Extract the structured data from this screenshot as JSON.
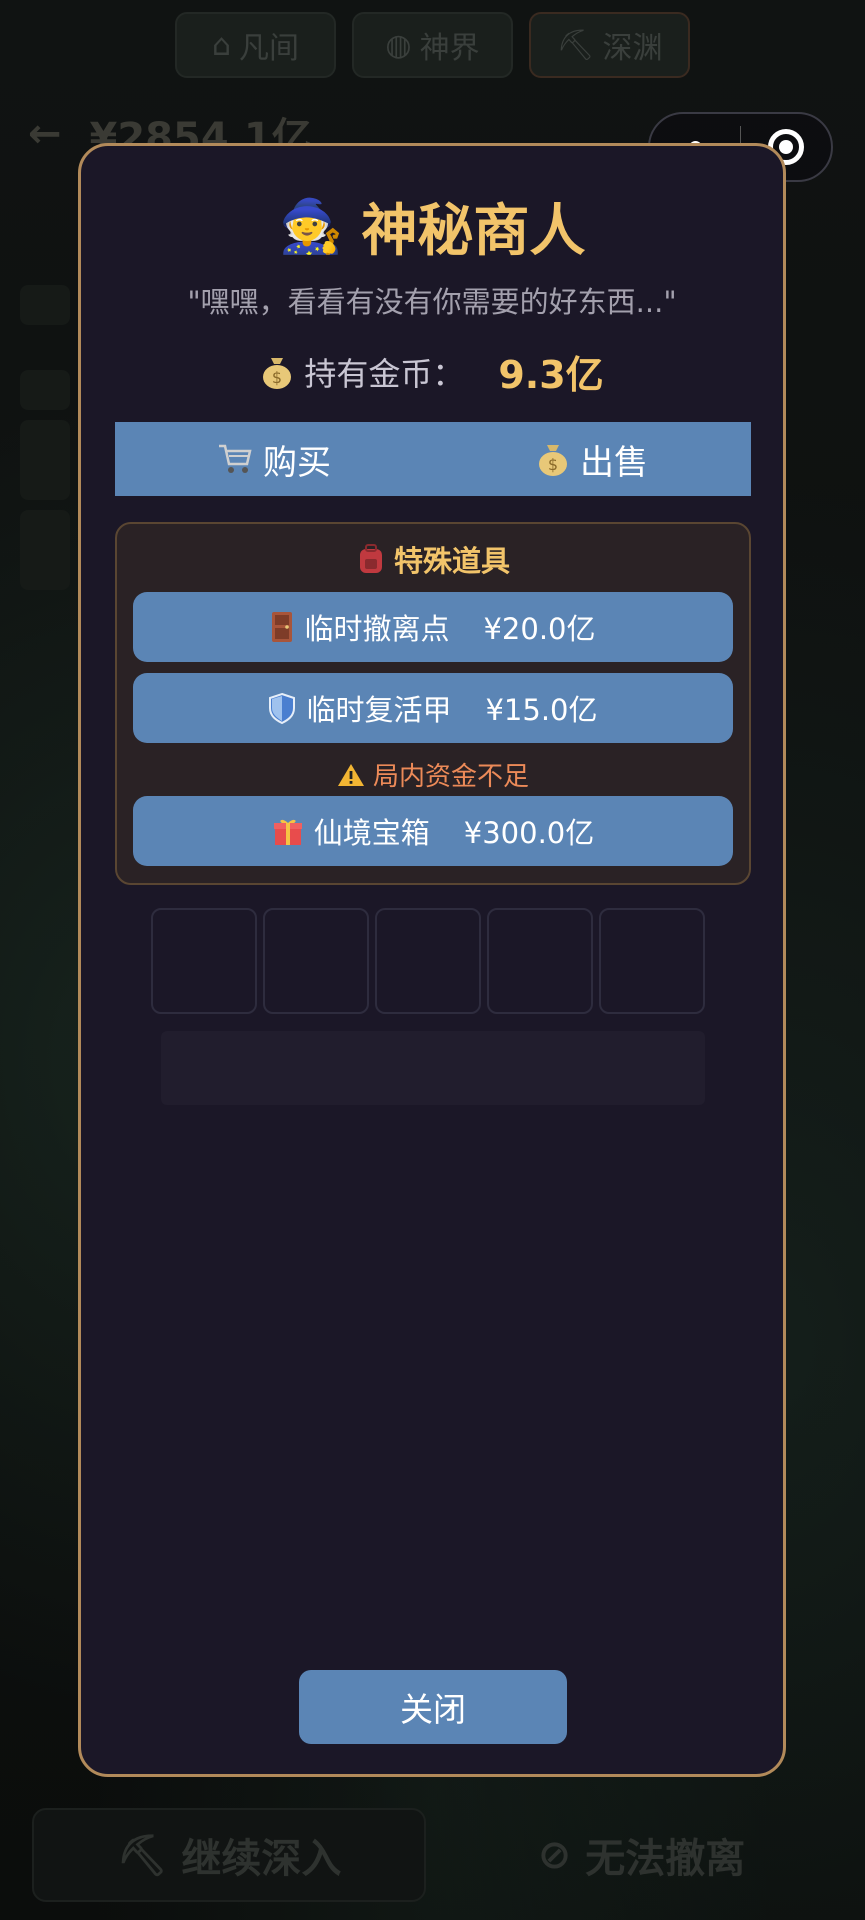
{
  "background": {
    "tabs": [
      "凡间",
      "神界",
      "深渊"
    ],
    "balance": "¥2854.1亿",
    "continue_label": "继续深入",
    "withdraw_label": "无法撤离"
  },
  "merchant": {
    "title": "神秘商人",
    "quote": "\"嘿嘿，看看有没有你需要的好东西...\"",
    "gold_label": "持有金币：",
    "gold_value": "9.3亿",
    "tabs": [
      {
        "label": "购买",
        "icon": "cart-icon"
      },
      {
        "label": "出售",
        "icon": "money-bag-icon"
      }
    ],
    "special": {
      "title": "特殊道具",
      "items": [
        {
          "icon": "door-icon",
          "name": "临时撤离点",
          "price": "¥20.0亿"
        },
        {
          "icon": "shield-icon",
          "name": "临时复活甲",
          "price": "¥15.0亿"
        },
        {
          "icon": "gift-icon",
          "name": "仙境宝箱",
          "price": "¥300.0亿"
        }
      ],
      "warning": "局内资金不足"
    },
    "close_label": "关闭"
  },
  "colors": {
    "accent_gold": "#f2c46a",
    "button_blue": "#5b85b5",
    "modal_bg": "#1b1727",
    "modal_border": "#b28a5a",
    "warning": "#ec8a58"
  }
}
